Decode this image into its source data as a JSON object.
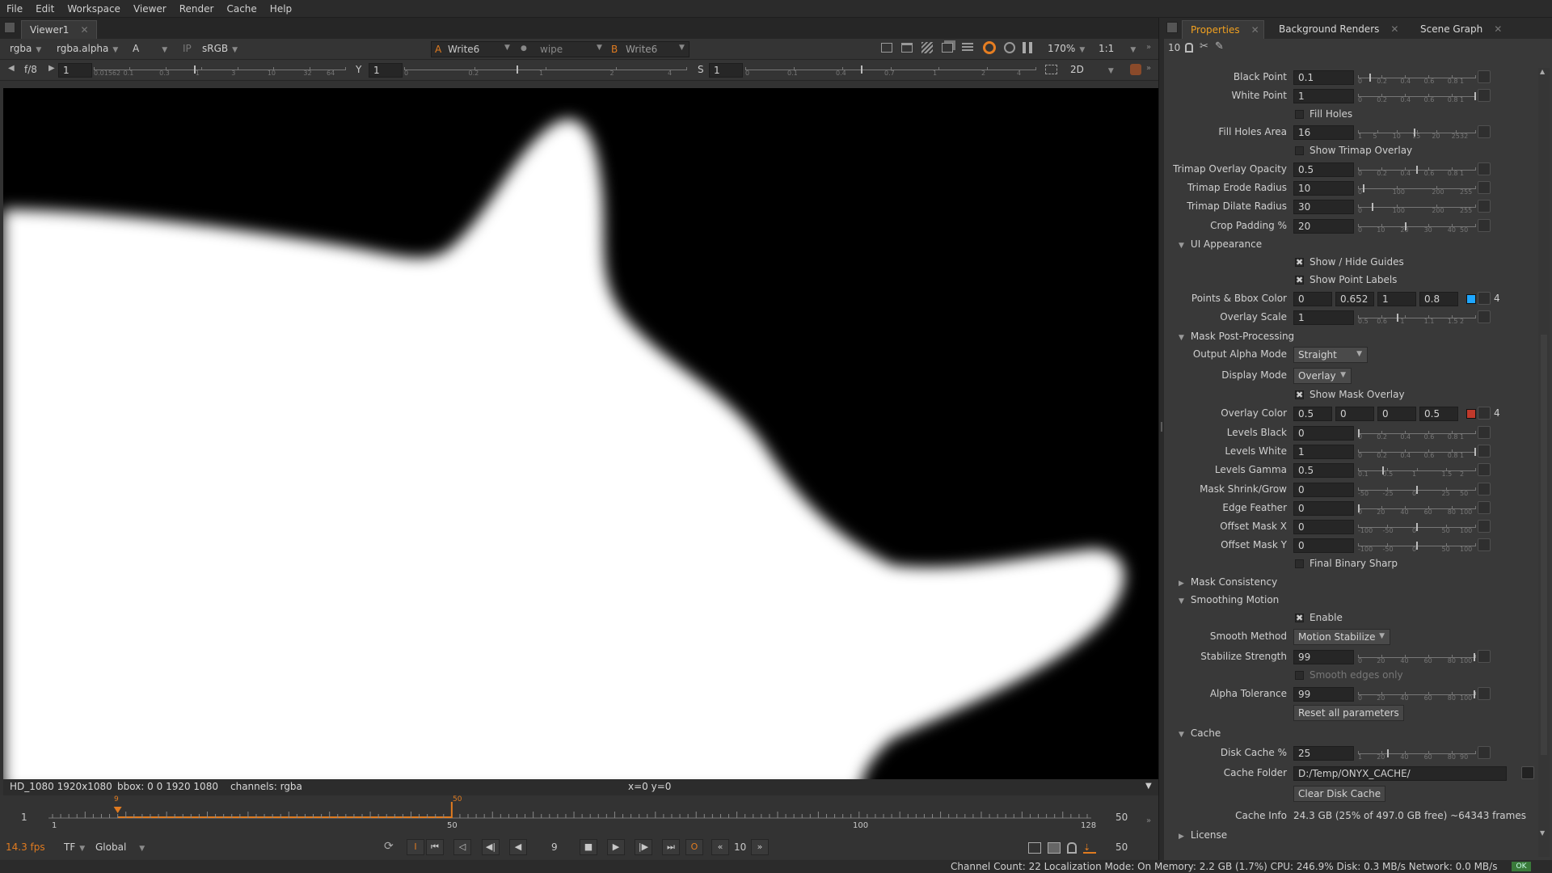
{
  "menu": [
    "File",
    "Edit",
    "Workspace",
    "Viewer",
    "Render",
    "Cache",
    "Help"
  ],
  "viewer_tab": "Viewer1",
  "toolbar1": {
    "channels": "rgba",
    "alpha": "rgba.alpha",
    "input_a": "A",
    "ip": "IP",
    "colorspace": "sRGB",
    "a_label": "A",
    "a_node": "Write6",
    "wipe": "wipe",
    "b_label": "B",
    "b_node": "Write6",
    "zoom": "170%",
    "ratio": "1:1"
  },
  "toolbar2": {
    "fstop": "f/8",
    "gain": "1",
    "gain_ticks": [
      "0.01562",
      "0.1",
      "0.3",
      "1",
      "3",
      "10",
      "32",
      "64"
    ],
    "y_label": "Y",
    "gamma": "1",
    "gamma_ticks": [
      "0",
      "0.2",
      "1",
      "2",
      "4"
    ],
    "s_label": "S",
    "sat": "1",
    "sat_ticks": [
      "0",
      "0.1",
      "0.4",
      "0.7",
      "1",
      "2",
      "4"
    ],
    "view_mode": "2D"
  },
  "info_bar": {
    "format": "HD_1080 1920x1080",
    "bbox": "bbox: 0 0 1920 1080",
    "channels": "channels: rgba",
    "coords": "x=0 y=0"
  },
  "timeline": {
    "frame_start": "1",
    "frame_end": "50",
    "labels": [
      "1",
      "50",
      "100",
      "128"
    ],
    "current_marker": "9",
    "mark_label": "50",
    "fps": "14.3 fps",
    "tf": "TF",
    "global": "Global",
    "current_frame": "9",
    "step": "10",
    "end_frame": "50"
  },
  "props_tabs": [
    "Properties",
    "Background Renders",
    "Scene Graph"
  ],
  "props_tools": {
    "count": "10"
  },
  "props": {
    "black_point": {
      "label": "Black Point",
      "value": "0.1",
      "ticks": [
        "0",
        "0.2",
        "0.4",
        "0.6",
        "0.8",
        "1"
      ]
    },
    "white_point": {
      "label": "White Point",
      "value": "1",
      "ticks": [
        "0",
        "0.2",
        "0.4",
        "0.6",
        "0.8",
        "1"
      ]
    },
    "fill_holes": {
      "label": "Fill Holes",
      "checked": ""
    },
    "fill_holes_area": {
      "label": "Fill Holes Area",
      "value": "16",
      "ticks": [
        "1",
        "5",
        "10",
        "15",
        "20",
        "25",
        "32"
      ]
    },
    "show_trimap": {
      "label": "Show Trimap Overlay",
      "checked": ""
    },
    "trimap_opacity": {
      "label": "Trimap Overlay Opacity",
      "value": "0.5",
      "ticks": [
        "0",
        "0.2",
        "0.4",
        "0.6",
        "0.8",
        "1"
      ]
    },
    "trimap_erode": {
      "label": "Trimap Erode Radius",
      "value": "10",
      "ticks": [
        "0",
        "100",
        "200",
        "255"
      ]
    },
    "trimap_dilate": {
      "label": "Trimap Dilate Radius",
      "value": "30",
      "ticks": [
        "0",
        "100",
        "200",
        "255"
      ]
    },
    "crop_padding": {
      "label": "Crop Padding %",
      "value": "20",
      "ticks": [
        "0",
        "10",
        "20",
        "30",
        "40",
        "50"
      ]
    },
    "ui_appearance": "UI Appearance",
    "show_hide_guides": {
      "label": "Show / Hide Guides",
      "checked": "✖"
    },
    "show_point_labels": {
      "label": "Show Point Labels",
      "checked": "✖"
    },
    "points_bbox_color": {
      "label": "Points & Bbox Color",
      "r": "0",
      "g": "0.652",
      "b": "1",
      "a": "0.8",
      "swatch": "#1ea6ff",
      "count": "4"
    },
    "overlay_scale": {
      "label": "Overlay Scale",
      "value": "1",
      "ticks": [
        "0.5",
        "0.6",
        "1",
        "1.1",
        "1.5",
        "2"
      ]
    },
    "mask_post": "Mask Post-Processing",
    "output_alpha_mode": {
      "label": "Output Alpha Mode",
      "value": "Straight"
    },
    "display_mode": {
      "label": "Display Mode",
      "value": "Overlay"
    },
    "show_mask_overlay": {
      "label": "Show Mask Overlay",
      "checked": "✖"
    },
    "overlay_color": {
      "label": "Overlay Color",
      "r": "0.5",
      "g": "0",
      "b": "0",
      "a": "0.5",
      "swatch": "#c0392b",
      "count": "4"
    },
    "levels_black": {
      "label": "Levels Black",
      "value": "0",
      "ticks": [
        "0",
        "0.2",
        "0.4",
        "0.6",
        "0.8",
        "1"
      ]
    },
    "levels_white": {
      "label": "Levels White",
      "value": "1",
      "ticks": [
        "0",
        "0.2",
        "0.4",
        "0.6",
        "0.8",
        "1"
      ]
    },
    "levels_gamma": {
      "label": "Levels Gamma",
      "value": "0.5",
      "ticks": [
        "0.1",
        "0.5",
        "1",
        "1.5",
        "2"
      ]
    },
    "mask_shrink": {
      "label": "Mask Shrink/Grow",
      "value": "0",
      "ticks": [
        "-50",
        "-25",
        "0",
        "25",
        "50"
      ]
    },
    "edge_feather": {
      "label": "Edge Feather",
      "value": "0",
      "ticks": [
        "0",
        "20",
        "40",
        "60",
        "80",
        "100"
      ]
    },
    "offset_x": {
      "label": "Offset Mask X",
      "value": "0",
      "ticks": [
        "-100",
        "-50",
        "0",
        "50",
        "100"
      ]
    },
    "offset_y": {
      "label": "Offset Mask Y",
      "value": "0",
      "ticks": [
        "-100",
        "-50",
        "0",
        "50",
        "100"
      ]
    },
    "final_binary": {
      "label": "Final Binary Sharp",
      "checked": ""
    },
    "mask_consistency": "Mask Consistency",
    "smoothing_motion": "Smoothing Motion",
    "enable": {
      "label": "Enable",
      "checked": "✖"
    },
    "smooth_method": {
      "label": "Smooth Method",
      "value": "Motion Stabilize"
    },
    "stabilize_strength": {
      "label": "Stabilize Strength",
      "value": "99",
      "ticks": [
        "0",
        "20",
        "40",
        "60",
        "80",
        "100"
      ]
    },
    "smooth_edges_only": {
      "label": "Smooth edges only",
      "checked": ""
    },
    "alpha_tolerance": {
      "label": "Alpha Tolerance",
      "value": "99",
      "ticks": [
        "0",
        "20",
        "40",
        "60",
        "80",
        "100"
      ]
    },
    "reset_all": "Reset all parameters",
    "cache": "Cache",
    "disk_cache": {
      "label": "Disk Cache %",
      "value": "25",
      "ticks": [
        "1",
        "20",
        "40",
        "60",
        "80",
        "90"
      ]
    },
    "cache_folder": {
      "label": "Cache Folder",
      "value": "D:/Temp/ONYX_CACHE/"
    },
    "clear_disk_cache": "Clear Disk Cache",
    "cache_info": {
      "label": "Cache Info",
      "value": "24.3 GB (25% of 497.0 GB free) ~64343 frames"
    },
    "license": "License"
  },
  "status": {
    "text": "Channel Count: 22  Localization Mode: On  Memory: 2.2 GB (1.7%)  CPU: 246.9%  Disk: 0.3 MB/s  Network: 0.0 MB/s",
    "badge": "OK"
  }
}
